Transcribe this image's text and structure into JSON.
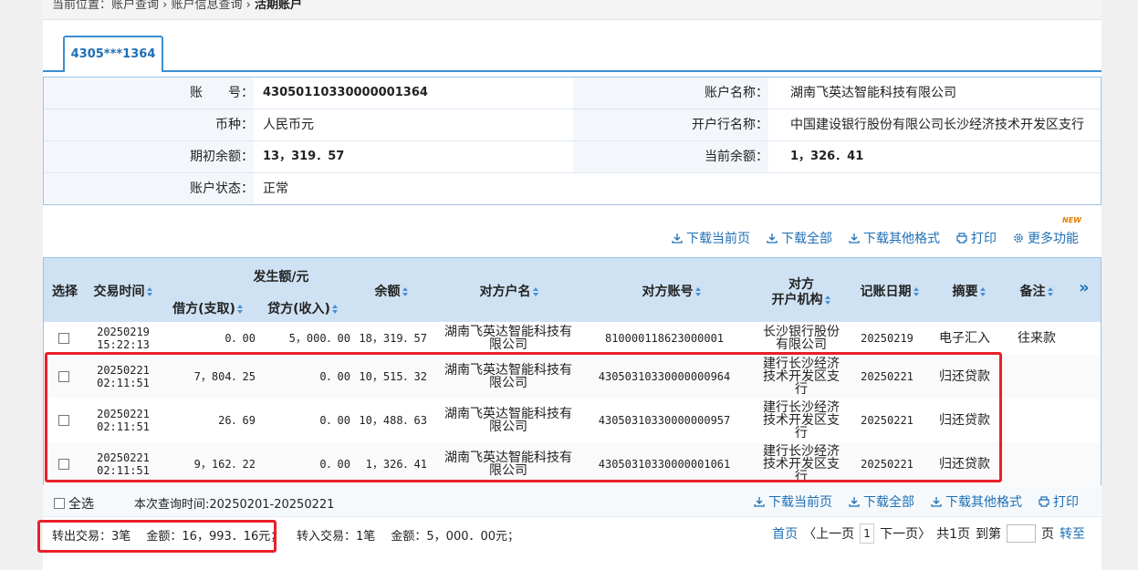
{
  "breadcrumb": {
    "prefix": "当前位置：",
    "items": [
      "账户查询",
      "账户信息查询"
    ],
    "current": "活期账户",
    "sep": "›"
  },
  "tab": {
    "label": "4305***1364"
  },
  "info": {
    "rows": [
      {
        "l1": "账　　号：",
        "v1": "43050110330000001364",
        "l2": "账户名称：",
        "v2": "湖南飞英达智能科技有限公司"
      },
      {
        "l1": "币种：",
        "v1": "人民币元",
        "l2": "开户行名称：",
        "v2": "中国建设银行股份有限公司长沙经济技术开发区支行"
      },
      {
        "l1": "期初余额：",
        "v1": "13，319．57",
        "l2": "当前余额：",
        "v2": "1，326．41"
      },
      {
        "l1": "账户状态：",
        "v1": "正常",
        "l2": "",
        "v2": ""
      }
    ]
  },
  "toolbar_top": {
    "items": [
      "下载当前页",
      "下载全部",
      "下载其他格式",
      "打印",
      "更多功能"
    ],
    "badge": "NEW"
  },
  "table": {
    "headers": {
      "select": "选择",
      "time": "交易时间",
      "amount_group": "发生额/元",
      "debit": "借方(支取)",
      "credit": "贷方(收入)",
      "balance": "余额",
      "cp_name": "对方户名",
      "cp_acct": "对方账号",
      "cp_org1": "对方",
      "cp_org2": "开户机构",
      "date": "记账日期",
      "summary": "摘要",
      "remark": "备注",
      "more": "»"
    },
    "rows": [
      {
        "d": "20250219",
        "t": "15:22:13",
        "debit": "0．00",
        "credit": "5，000．00",
        "bal": "18，319．57",
        "name": "湖南飞英达智能科技有限公司",
        "acct": "810000118623000001",
        "org": "长沙银行股份有限公司",
        "date": "20250219",
        "sum": "电子汇入",
        "rem": "往来款"
      },
      {
        "d": "20250221",
        "t": "02:11:51",
        "debit": "7，804．25",
        "credit": "0．00",
        "bal": "10，515．32",
        "name": "湖南飞英达智能科技有限公司",
        "acct": "43050310330000000964",
        "org": "建行长沙经济技术开发区支行",
        "date": "20250221",
        "sum": "归还贷款",
        "rem": ""
      },
      {
        "d": "20250221",
        "t": "02:11:51",
        "debit": "26．69",
        "credit": "0．00",
        "bal": "10，488．63",
        "name": "湖南飞英达智能科技有限公司",
        "acct": "43050310330000000957",
        "org": "建行长沙经济技术开发区支行",
        "date": "20250221",
        "sum": "归还贷款",
        "rem": ""
      },
      {
        "d": "20250221",
        "t": "02:11:51",
        "debit": "9，162．22",
        "credit": "0．00",
        "bal": "1，326．41",
        "name": "湖南飞英达智能科技有限公司",
        "acct": "43050310330000001061",
        "org": "建行长沙经济技术开发区支行",
        "date": "20250221",
        "sum": "归还贷款",
        "rem": ""
      }
    ]
  },
  "footer": {
    "select_all": "全选",
    "query_time": "本次查询时间:20250201-20250221",
    "toolbar": [
      "下载当前页",
      "下载全部",
      "下载其他格式",
      "打印"
    ],
    "out_summary": "转出交易：3笔　 金额：16，993．16元；",
    "in_summary": "转入交易：1笔　 金额：5，000．00元；",
    "pager": {
      "first": "首页",
      "prev": "〈上一页",
      "page": "1",
      "next": "下一页〉",
      "total": "共1页",
      "goto": "到第",
      "unit": "页",
      "go": "转至"
    }
  },
  "colors": {
    "accent": "#1e6fb5",
    "header_bg": "#cfe2f3",
    "highlight": "#e8202a"
  }
}
